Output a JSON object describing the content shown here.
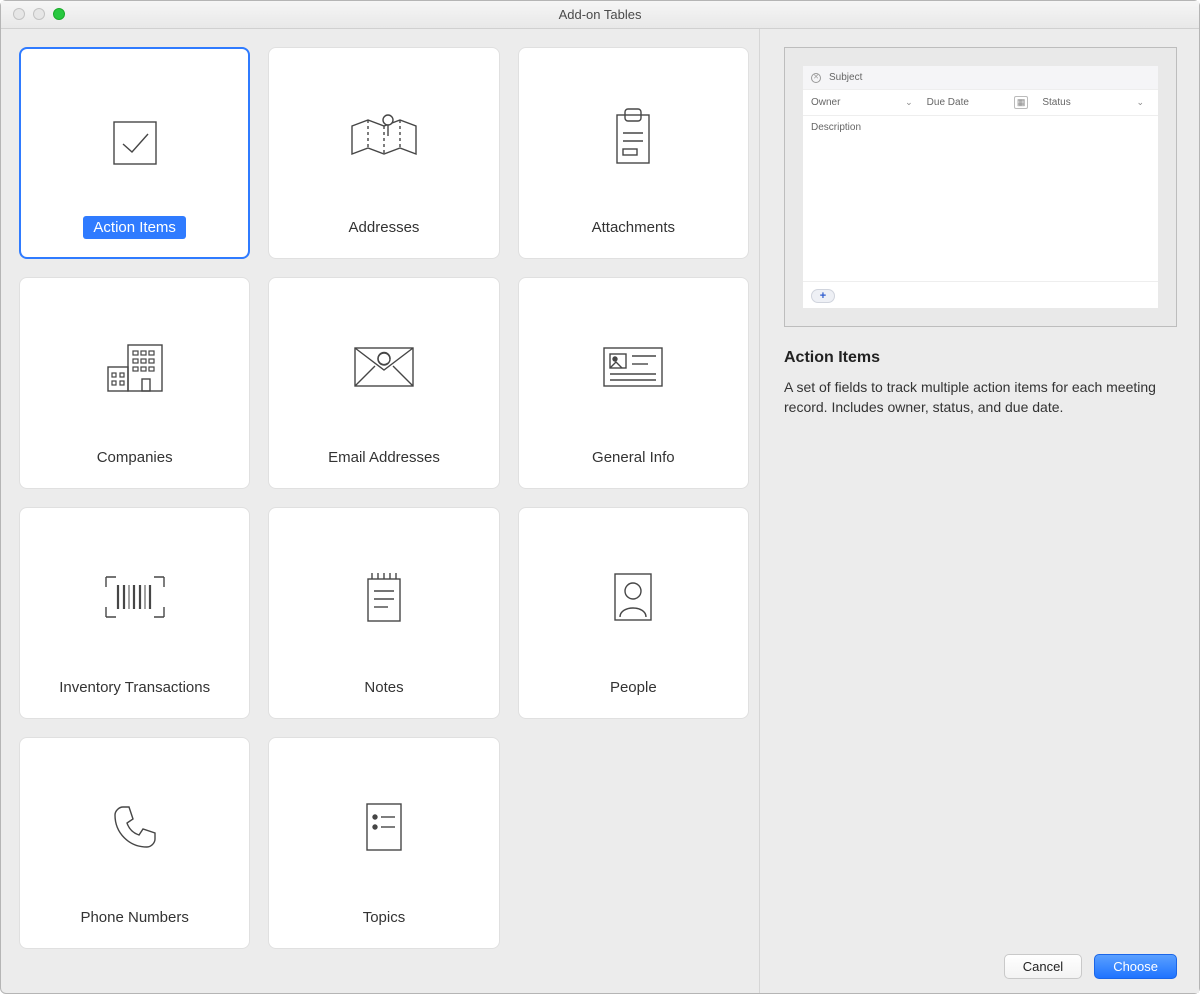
{
  "window": {
    "title": "Add-on Tables"
  },
  "tiles": [
    {
      "label": "Action Items",
      "selected": true
    },
    {
      "label": "Addresses",
      "selected": false
    },
    {
      "label": "Attachments",
      "selected": false
    },
    {
      "label": "Companies",
      "selected": false
    },
    {
      "label": "Email Addresses",
      "selected": false
    },
    {
      "label": "General Info",
      "selected": false
    },
    {
      "label": "Inventory Transactions",
      "selected": false
    },
    {
      "label": "Notes",
      "selected": false
    },
    {
      "label": "People",
      "selected": false
    },
    {
      "label": "Phone Numbers",
      "selected": false
    },
    {
      "label": "Topics",
      "selected": false
    }
  ],
  "preview": {
    "fields": {
      "subject": "Subject",
      "owner": "Owner",
      "due_date": "Due Date",
      "status": "Status",
      "description": "Description"
    },
    "add_symbol": "+"
  },
  "detail": {
    "title": "Action Items",
    "description": "A set of fields to track multiple action items for each meeting record. Includes owner, status, and due date."
  },
  "buttons": {
    "cancel": "Cancel",
    "choose": "Choose"
  }
}
